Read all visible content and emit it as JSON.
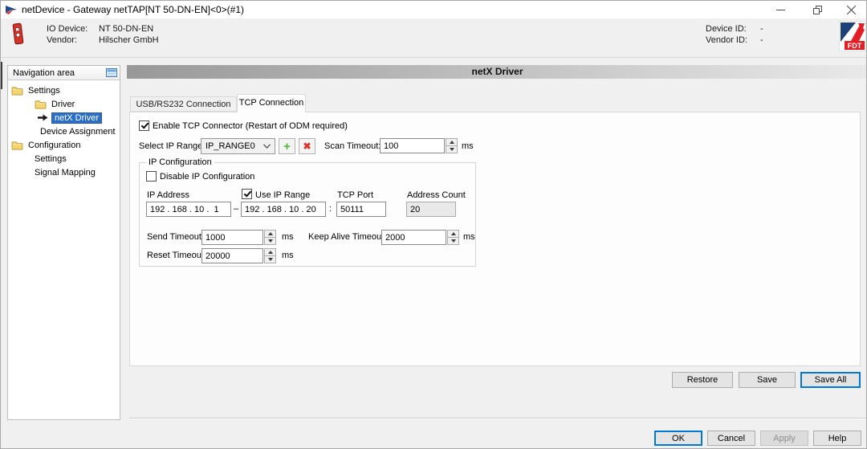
{
  "window": {
    "title": "netDevice - Gateway netTAP[NT 50-DN-EN]<0>(#1)"
  },
  "header": {
    "io_device_label": "IO Device:",
    "io_device_value": "NT 50-DN-EN",
    "vendor_label": "Vendor:",
    "vendor_value": "Hilscher GmbH",
    "device_id_label": "Device ID:",
    "device_id_value": "-",
    "vendor_id_label": "Vendor ID:",
    "vendor_id_value": "-",
    "logo_text": "FDT"
  },
  "navigation": {
    "title": "Navigation area",
    "items": [
      {
        "label": "Settings"
      },
      {
        "label": "Driver"
      },
      {
        "label": "netX Driver",
        "selected": true
      },
      {
        "label": "Device Assignment"
      },
      {
        "label": "Configuration"
      },
      {
        "label": "Settings"
      },
      {
        "label": "Signal Mapping"
      }
    ]
  },
  "main": {
    "panel_title": "netX Driver",
    "tabs": [
      {
        "label": "USB/RS232 Connection",
        "active": false
      },
      {
        "label": "TCP Connection",
        "active": true
      }
    ],
    "tcp_tab": {
      "enable_checkbox": {
        "label": "Enable TCP Connector (Restart of ODM required)",
        "checked": true
      },
      "select_ip_range": {
        "label": "Select IP Range:",
        "value": "IP_RANGE0"
      },
      "scan_timeout": {
        "label": "Scan Timeout:",
        "value": "100",
        "unit": "ms"
      },
      "ip_configuration": {
        "title": "IP Configuration",
        "disable_checkbox": {
          "label": "Disable IP Configuration",
          "checked": false
        },
        "ip_address": {
          "label": "IP Address",
          "start": "192 . 168 . 10 .  1",
          "end": "192 . 168 . 10 . 20",
          "separator": "–"
        },
        "use_ip_range": {
          "label": "Use IP Range",
          "checked": true
        },
        "tcp_port": {
          "label": "TCP Port",
          "value": "50111",
          "separator": ":"
        },
        "address_count": {
          "label": "Address Count",
          "value": "20"
        },
        "send_timeout": {
          "label": "Send Timeout:",
          "value": "1000",
          "unit": "ms"
        },
        "keep_alive_timeout": {
          "label": "Keep Alive Timeout:",
          "value": "2000",
          "unit": "ms"
        },
        "reset_timeout": {
          "label": "Reset Timeout:",
          "value": "20000",
          "unit": "ms"
        }
      },
      "actions": {
        "restore": "Restore",
        "save": "Save",
        "save_all": "Save All"
      }
    }
  },
  "footer": {
    "ok": "OK",
    "cancel": "Cancel",
    "apply": "Apply",
    "help": "Help"
  }
}
